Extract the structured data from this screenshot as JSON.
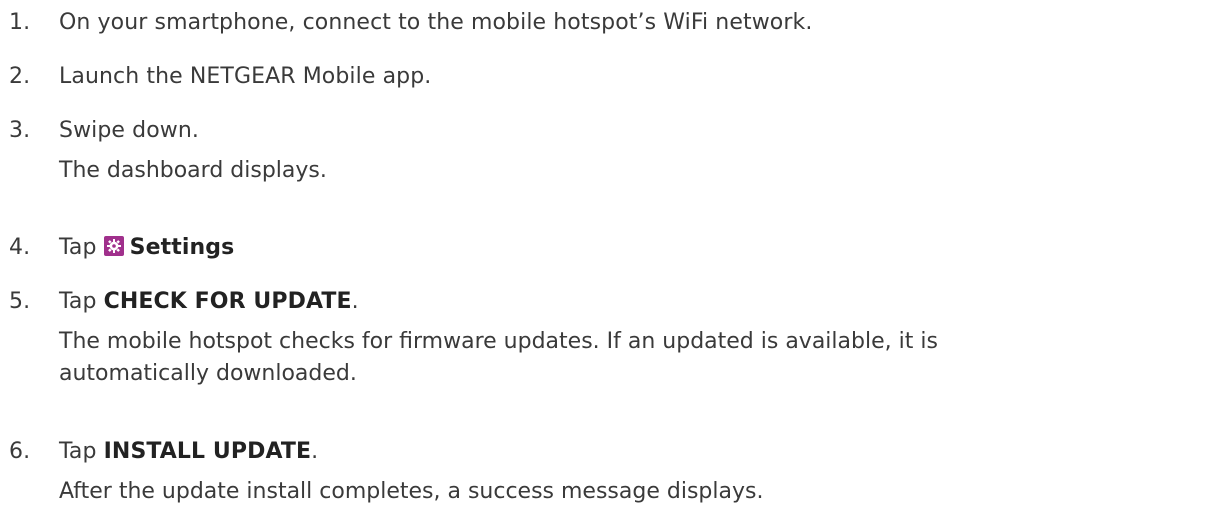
{
  "steps": [
    {
      "number": "1.",
      "text": "On your smartphone, connect to the mobile hotspot’s WiFi network."
    },
    {
      "number": "2.",
      "text": "Launch the NETGEAR Mobile app."
    },
    {
      "number": "3.",
      "text": "Swipe down.",
      "result": "The dashboard displays."
    },
    {
      "number": "4.",
      "prefix": "Tap",
      "bold": "Settings",
      "suffix": "",
      "icon": "settings-gear-icon"
    },
    {
      "number": "5.",
      "prefix": "Tap",
      "bold": "CHECK FOR UPDATE",
      "suffix": ".",
      "result_line1": "The mobile hotspot checks for firmware updates. If an updated is available, it is",
      "result_line2": "automatically downloaded."
    },
    {
      "number": "6.",
      "prefix": "Tap",
      "bold": "INSTALL UPDATE",
      "suffix": ".",
      "result": "After the update install completes, a success message displays."
    }
  ],
  "colors": {
    "text": "#3a3a3a",
    "icon_bg": "#a0308c",
    "icon_fg": "#ffffff"
  }
}
